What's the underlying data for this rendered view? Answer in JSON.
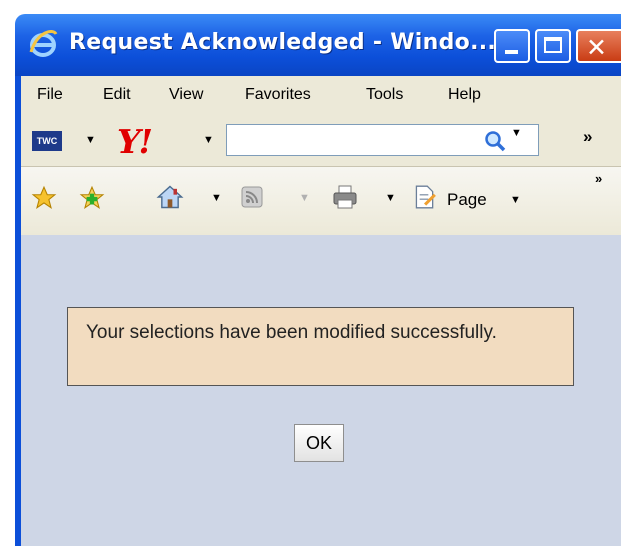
{
  "window": {
    "title": "Request Acknowledged - Windo...",
    "title_bar_color": "#0c4fd9",
    "close_button_color": "#d1471f"
  },
  "menubar": {
    "items": [
      "File",
      "Edit",
      "View",
      "Favorites",
      "Tools",
      "Help"
    ]
  },
  "links_toolbar": {
    "twc_label": "TWC",
    "search_value": "",
    "overflow_label": "»"
  },
  "command_toolbar": {
    "page_label": "Page",
    "overflow_label": "»"
  },
  "dialog": {
    "message": "Your selections have been modified successfully.",
    "ok_label": "OK",
    "message_bg": "#f2dcc0",
    "content_bg": "#ced6e6"
  }
}
